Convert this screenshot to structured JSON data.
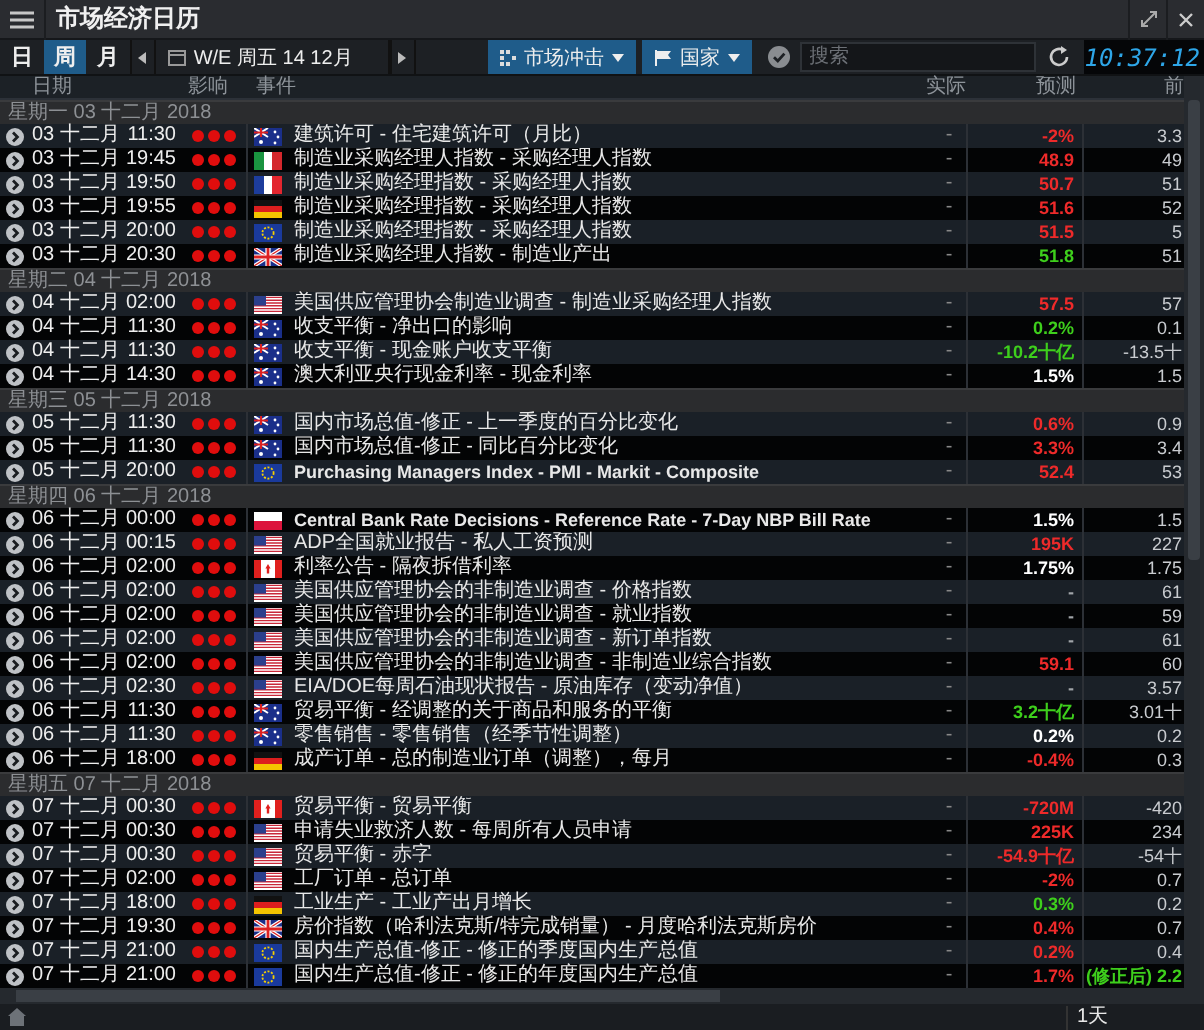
{
  "window": {
    "title": "市场经济日历"
  },
  "tabs": [
    {
      "label": "日",
      "selected": false
    },
    {
      "label": "周",
      "selected": true
    },
    {
      "label": "月",
      "selected": false
    }
  ],
  "period": "W/E 周五 14 12月",
  "filters": [
    {
      "label": "市场冲击"
    },
    {
      "label": "国家"
    }
  ],
  "search": {
    "placeholder": "搜索"
  },
  "clock": "10:37:12",
  "columns": {
    "date": "日期",
    "impact": "影响",
    "event": "事件",
    "actual": "实际",
    "forecast": "预测",
    "previous": "前"
  },
  "groups": [
    {
      "label": "星期一 03 十二月 2018",
      "rows": [
        {
          "date": "03 十二月",
          "time": "11:30",
          "stars": 3,
          "kind": "au",
          "event": "建筑许可 - 住宅建筑许可（月比）",
          "actual": "-",
          "forecast": {
            "text": "-2%",
            "color": "#ee2a2a"
          },
          "previous": "3.3"
        },
        {
          "date": "03 十二月",
          "time": "19:45",
          "stars": 3,
          "kind": "it",
          "event": "制造业采购经理人指数 - 采购经理人指数",
          "actual": "-",
          "forecast": {
            "text": "48.9",
            "color": "#ee2a2a"
          },
          "previous": "49"
        },
        {
          "date": "03 十二月",
          "time": "19:50",
          "stars": 3,
          "kind": "fr",
          "event": "制造业采购经理指数 - 采购经理人指数",
          "actual": "-",
          "forecast": {
            "text": "50.7",
            "color": "#ee2a2a"
          },
          "previous": "51"
        },
        {
          "date": "03 十二月",
          "time": "19:55",
          "stars": 3,
          "kind": "de",
          "event": "制造业采购经理指数 - 采购经理人指数",
          "actual": "-",
          "forecast": {
            "text": "51.6",
            "color": "#ee2a2a"
          },
          "previous": "52"
        },
        {
          "date": "03 十二月",
          "time": "20:00",
          "stars": 3,
          "kind": "eu",
          "event": "制造业采购经理指数 - 采购经理人指数",
          "actual": "-",
          "forecast": {
            "text": "51.5",
            "color": "#ee2a2a"
          },
          "previous": "5"
        },
        {
          "date": "03 十二月",
          "time": "20:30",
          "stars": 3,
          "kind": "gb",
          "event": "制造业采购经理人指数 - 制造业产出",
          "actual": "-",
          "forecast": {
            "text": "51.8",
            "color": "#3ecf1c"
          },
          "previous": "51"
        }
      ]
    },
    {
      "label": "星期二 04 十二月 2018",
      "rows": [
        {
          "date": "04 十二月",
          "time": "02:00",
          "stars": 3,
          "kind": "us",
          "event": "美国供应管理协会制造业调查 - 制造业采购经理人指数",
          "actual": "-",
          "forecast": {
            "text": "57.5",
            "color": "#ee2a2a"
          },
          "previous": "57"
        },
        {
          "date": "04 十二月",
          "time": "11:30",
          "stars": 3,
          "kind": "au",
          "event": "收支平衡 - 净出口的影响",
          "actual": "-",
          "forecast": {
            "text": "0.2%",
            "color": "#3ecf1c"
          },
          "previous": "0.1"
        },
        {
          "date": "04 十二月",
          "time": "11:30",
          "stars": 3,
          "kind": "au",
          "event": "收支平衡 - 现金账户收支平衡",
          "actual": "-",
          "forecast": {
            "text": "-10.2十亿",
            "color": "#3ecf1c"
          },
          "previous": "-13.5十"
        },
        {
          "date": "04 十二月",
          "time": "14:30",
          "stars": 3,
          "kind": "au",
          "event": "澳大利亚央行现金利率 - 现金利率",
          "actual": "-",
          "forecast": {
            "text": "1.5%",
            "color": "#ffffff"
          },
          "previous": "1.5"
        }
      ]
    },
    {
      "label": "星期三 05 十二月 2018",
      "rows": [
        {
          "date": "05 十二月",
          "time": "11:30",
          "stars": 3,
          "kind": "au",
          "event": "国内市场总值-修正 - 上一季度的百分比变化",
          "actual": "-",
          "forecast": {
            "text": "0.6%",
            "color": "#ee2a2a"
          },
          "previous": "0.9"
        },
        {
          "date": "05 十二月",
          "time": "11:30",
          "stars": 3,
          "kind": "au",
          "event": "国内市场总值-修正 - 同比百分比变化",
          "actual": "-",
          "forecast": {
            "text": "3.3%",
            "color": "#ee2a2a"
          },
          "previous": "3.4"
        },
        {
          "date": "05 十二月",
          "time": "20:00",
          "stars": 3,
          "kind": "eu",
          "event": "Purchasing Managers Index - PMI - Markit - Composite",
          "actual": "-",
          "forecast": {
            "text": "52.4",
            "color": "#ee2a2a"
          },
          "previous": "53"
        }
      ]
    },
    {
      "label": "星期四 06 十二月 2018",
      "rows": [
        {
          "date": "06 十二月",
          "time": "00:00",
          "stars": 3,
          "kind": "pl",
          "event": "Central Bank Rate Decisions - Reference Rate - 7-Day NBP Bill Rate",
          "actual": "-",
          "forecast": {
            "text": "1.5%",
            "color": "#ffffff"
          },
          "previous": "1.5"
        },
        {
          "date": "06 十二月",
          "time": "00:15",
          "stars": 3,
          "kind": "us",
          "event": "ADP全国就业报告 - 私人工资预测",
          "actual": "-",
          "forecast": {
            "text": "195K",
            "color": "#ee2a2a"
          },
          "previous": "227"
        },
        {
          "date": "06 十二月",
          "time": "02:00",
          "stars": 3,
          "kind": "ca",
          "event": "利率公告 - 隔夜拆借利率",
          "actual": "-",
          "forecast": {
            "text": "1.75%",
            "color": "#ffffff"
          },
          "previous": "1.75"
        },
        {
          "date": "06 十二月",
          "time": "02:00",
          "stars": 3,
          "kind": "us",
          "event": "美国供应管理协会的非制造业调查 - 价格指数",
          "actual": "-",
          "forecast": {
            "text": "-",
            "color": "#a0a4a8"
          },
          "previous": "61"
        },
        {
          "date": "06 十二月",
          "time": "02:00",
          "stars": 3,
          "kind": "us",
          "event": "美国供应管理协会的非制造业调查 - 就业指数",
          "actual": "-",
          "forecast": {
            "text": "-",
            "color": "#a0a4a8"
          },
          "previous": "59"
        },
        {
          "date": "06 十二月",
          "time": "02:00",
          "stars": 3,
          "kind": "us",
          "event": "美国供应管理协会的非制造业调查 - 新订单指数",
          "actual": "-",
          "forecast": {
            "text": "-",
            "color": "#a0a4a8"
          },
          "previous": "61"
        },
        {
          "date": "06 十二月",
          "time": "02:00",
          "stars": 3,
          "kind": "us",
          "event": "美国供应管理协会的非制造业调查 - 非制造业综合指数",
          "actual": "-",
          "forecast": {
            "text": "59.1",
            "color": "#ee2a2a"
          },
          "previous": "60"
        },
        {
          "date": "06 十二月",
          "time": "02:30",
          "stars": 3,
          "kind": "us",
          "event": "EIA/DOE每周石油现状报告 - 原油库存（变动净值）",
          "actual": "-",
          "forecast": {
            "text": "-",
            "color": "#a0a4a8"
          },
          "previous": "3.57"
        },
        {
          "date": "06 十二月",
          "time": "11:30",
          "stars": 3,
          "kind": "au",
          "event": "贸易平衡 - 经调整的关于商品和服务的平衡",
          "actual": "-",
          "forecast": {
            "text": "3.2十亿",
            "color": "#3ecf1c"
          },
          "previous": "3.01十"
        },
        {
          "date": "06 十二月",
          "time": "11:30",
          "stars": 3,
          "kind": "au",
          "event": "零售销售 - 零售销售（经季节性调整）",
          "actual": "-",
          "forecast": {
            "text": "0.2%",
            "color": "#ffffff"
          },
          "previous": "0.2"
        },
        {
          "date": "06 十二月",
          "time": "18:00",
          "stars": 3,
          "kind": "de",
          "event": "成产订单 - 总的制造业订单（调整），每月",
          "actual": "-",
          "forecast": {
            "text": "-0.4%",
            "color": "#ee2a2a"
          },
          "previous": "0.3"
        }
      ]
    },
    {
      "label": "星期五 07 十二月 2018",
      "rows": [
        {
          "date": "07 十二月",
          "time": "00:30",
          "stars": 3,
          "kind": "ca",
          "event": "贸易平衡 - 贸易平衡",
          "actual": "-",
          "forecast": {
            "text": "-720M",
            "color": "#ee2a2a"
          },
          "previous": "-420"
        },
        {
          "date": "07 十二月",
          "time": "00:30",
          "stars": 3,
          "kind": "us",
          "event": "申请失业救济人数 - 每周所有人员申请",
          "actual": "-",
          "forecast": {
            "text": "225K",
            "color": "#ee2a2a"
          },
          "previous": "234"
        },
        {
          "date": "07 十二月",
          "time": "00:30",
          "stars": 3,
          "kind": "us",
          "event": "贸易平衡 - 赤字",
          "actual": "-",
          "forecast": {
            "text": "-54.9十亿",
            "color": "#ee2a2a"
          },
          "previous": "-54十"
        },
        {
          "date": "07 十二月",
          "time": "02:00",
          "stars": 3,
          "kind": "us",
          "event": "工厂订单 - 总订单",
          "actual": "-",
          "forecast": {
            "text": "-2%",
            "color": "#ee2a2a"
          },
          "previous": "0.7"
        },
        {
          "date": "07 十二月",
          "time": "18:00",
          "stars": 3,
          "kind": "de",
          "event": "工业生产 - 工业产出月增长",
          "actual": "-",
          "forecast": {
            "text": "0.3%",
            "color": "#3ecf1c"
          },
          "previous": "0.2"
        },
        {
          "date": "07 十二月",
          "time": "19:30",
          "stars": 3,
          "kind": "gb",
          "event": "房价指数（哈利法克斯/特完成销量） - 月度哈利法克斯房价",
          "actual": "-",
          "forecast": {
            "text": "0.4%",
            "color": "#ee2a2a"
          },
          "previous": "0.7"
        },
        {
          "date": "07 十二月",
          "time": "21:00",
          "stars": 3,
          "kind": "eu",
          "event": "国内生产总值-修正 - 修正的季度国内生产总值",
          "actual": "-",
          "forecast": {
            "text": "0.2%",
            "color": "#ee2a2a"
          },
          "previous": "0.4"
        },
        {
          "date": "07 十二月",
          "time": "21:00",
          "stars": 3,
          "kind": "eu",
          "event": "国内生产总值-修正 - 修正的年度国内生产总值",
          "actual": "-",
          "forecast": {
            "text": "1.7%",
            "color": "#ee2a2a"
          },
          "previous": {
            "text": "(修正后) 2.2",
            "color": "#3ecf1c"
          }
        }
      ]
    }
  ],
  "footer": {
    "range": "1天"
  }
}
